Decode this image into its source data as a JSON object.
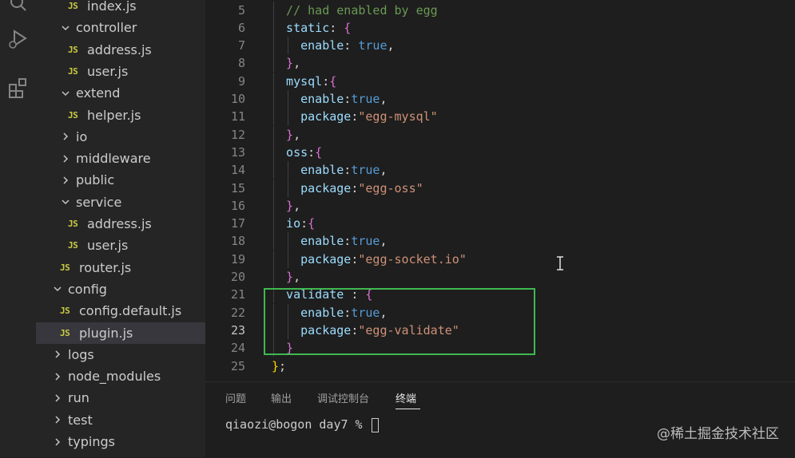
{
  "explorer": {
    "items": [
      {
        "label": "index.js",
        "type": "file",
        "badge": "JS",
        "indent": 2
      },
      {
        "label": "controller",
        "type": "folder",
        "open": true,
        "indent": 1
      },
      {
        "label": "address.js",
        "type": "file",
        "badge": "JS",
        "indent": 2
      },
      {
        "label": "user.js",
        "type": "file",
        "badge": "JS",
        "indent": 2
      },
      {
        "label": "extend",
        "type": "folder",
        "open": true,
        "indent": 1
      },
      {
        "label": "helper.js",
        "type": "file",
        "badge": "JS",
        "indent": 2
      },
      {
        "label": "io",
        "type": "folder",
        "open": false,
        "indent": 1
      },
      {
        "label": "middleware",
        "type": "folder",
        "open": false,
        "indent": 1
      },
      {
        "label": "public",
        "type": "folder",
        "open": false,
        "indent": 1
      },
      {
        "label": "service",
        "type": "folder",
        "open": true,
        "indent": 1
      },
      {
        "label": "address.js",
        "type": "file",
        "badge": "JS",
        "indent": 2
      },
      {
        "label": "user.js",
        "type": "file",
        "badge": "JS",
        "indent": 2
      },
      {
        "label": "router.js",
        "type": "file",
        "badge": "JS",
        "indent": 1
      },
      {
        "label": "config",
        "type": "folder",
        "open": true,
        "indent": 0
      },
      {
        "label": "config.default.js",
        "type": "file",
        "badge": "JS",
        "indent": 1
      },
      {
        "label": "plugin.js",
        "type": "file",
        "badge": "JS",
        "indent": 1,
        "selected": true
      },
      {
        "label": "logs",
        "type": "folder",
        "open": false,
        "indent": 0
      },
      {
        "label": "node_modules",
        "type": "folder",
        "open": false,
        "indent": 0
      },
      {
        "label": "run",
        "type": "folder",
        "open": false,
        "indent": 0
      },
      {
        "label": "test",
        "type": "folder",
        "open": false,
        "indent": 0
      },
      {
        "label": "typings",
        "type": "folder",
        "open": false,
        "indent": 0
      }
    ]
  },
  "editor": {
    "active_line": 23,
    "lines": [
      {
        "n": "5",
        "indent": 1,
        "tokens": [
          [
            "c-comment",
            "// had enabled by egg"
          ]
        ]
      },
      {
        "n": "6",
        "indent": 1,
        "tokens": [
          [
            "c-key",
            "static"
          ],
          [
            "c-punc",
            ": "
          ],
          [
            "c-brace",
            "{"
          ]
        ]
      },
      {
        "n": "7",
        "indent": 2,
        "tokens": [
          [
            "c-key",
            "enable"
          ],
          [
            "c-punc",
            ": "
          ],
          [
            "c-bool",
            "true"
          ],
          [
            "c-punc",
            ","
          ]
        ]
      },
      {
        "n": "8",
        "indent": 1,
        "tokens": [
          [
            "c-brace",
            "}"
          ],
          [
            "c-punc",
            ","
          ]
        ]
      },
      {
        "n": "9",
        "indent": 1,
        "tokens": [
          [
            "c-key",
            "mysql"
          ],
          [
            "c-punc",
            ":"
          ],
          [
            "c-brace",
            "{"
          ]
        ]
      },
      {
        "n": "10",
        "indent": 2,
        "tokens": [
          [
            "c-key",
            "enable"
          ],
          [
            "c-punc",
            ":"
          ],
          [
            "c-bool",
            "true"
          ],
          [
            "c-punc",
            ","
          ]
        ]
      },
      {
        "n": "11",
        "indent": 2,
        "tokens": [
          [
            "c-key",
            "package"
          ],
          [
            "c-punc",
            ":"
          ],
          [
            "c-str",
            "\"egg-mysql\""
          ]
        ]
      },
      {
        "n": "12",
        "indent": 1,
        "tokens": [
          [
            "c-brace",
            "}"
          ],
          [
            "c-punc",
            ","
          ]
        ]
      },
      {
        "n": "13",
        "indent": 1,
        "tokens": [
          [
            "c-key",
            "oss"
          ],
          [
            "c-punc",
            ":"
          ],
          [
            "c-brace",
            "{"
          ]
        ]
      },
      {
        "n": "14",
        "indent": 2,
        "tokens": [
          [
            "c-key",
            "enable"
          ],
          [
            "c-punc",
            ":"
          ],
          [
            "c-bool",
            "true"
          ],
          [
            "c-punc",
            ","
          ]
        ]
      },
      {
        "n": "15",
        "indent": 2,
        "tokens": [
          [
            "c-key",
            "package"
          ],
          [
            "c-punc",
            ":"
          ],
          [
            "c-str",
            "\"egg-oss\""
          ]
        ]
      },
      {
        "n": "16",
        "indent": 1,
        "tokens": [
          [
            "c-brace",
            "}"
          ],
          [
            "c-punc",
            ","
          ]
        ]
      },
      {
        "n": "17",
        "indent": 1,
        "tokens": [
          [
            "c-key",
            "io"
          ],
          [
            "c-punc",
            ":"
          ],
          [
            "c-brace",
            "{"
          ]
        ]
      },
      {
        "n": "18",
        "indent": 2,
        "tokens": [
          [
            "c-key",
            "enable"
          ],
          [
            "c-punc",
            ":"
          ],
          [
            "c-bool",
            "true"
          ],
          [
            "c-punc",
            ","
          ]
        ]
      },
      {
        "n": "19",
        "indent": 2,
        "tokens": [
          [
            "c-key",
            "package"
          ],
          [
            "c-punc",
            ":"
          ],
          [
            "c-str",
            "\"egg-socket.io\""
          ]
        ]
      },
      {
        "n": "20",
        "indent": 1,
        "tokens": [
          [
            "c-brace",
            "}"
          ],
          [
            "c-punc",
            ","
          ]
        ]
      },
      {
        "n": "21",
        "indent": 1,
        "tokens": [
          [
            "c-key",
            "validate"
          ],
          [
            "c-punc",
            " : "
          ],
          [
            "c-brace",
            "{"
          ]
        ]
      },
      {
        "n": "22",
        "indent": 2,
        "tokens": [
          [
            "c-key",
            "enable"
          ],
          [
            "c-punc",
            ":"
          ],
          [
            "c-bool",
            "true"
          ],
          [
            "c-punc",
            ","
          ]
        ]
      },
      {
        "n": "23",
        "indent": 2,
        "tokens": [
          [
            "c-key",
            "package"
          ],
          [
            "c-punc",
            ":"
          ],
          [
            "c-str",
            "\"egg-validate\""
          ]
        ]
      },
      {
        "n": "24",
        "indent": 1,
        "tokens": [
          [
            "c-brace",
            "}"
          ]
        ]
      },
      {
        "n": "25",
        "indent": 0,
        "tokens": [
          [
            "c-brace-y",
            "}"
          ],
          [
            "c-punc",
            ";"
          ]
        ]
      }
    ]
  },
  "panel": {
    "tabs": [
      "问题",
      "输出",
      "调试控制台",
      "终端"
    ],
    "active_tab": "终端",
    "prompt": "qiaozi@bogon day7 % "
  },
  "watermark": "@稀土掘金技术社区"
}
